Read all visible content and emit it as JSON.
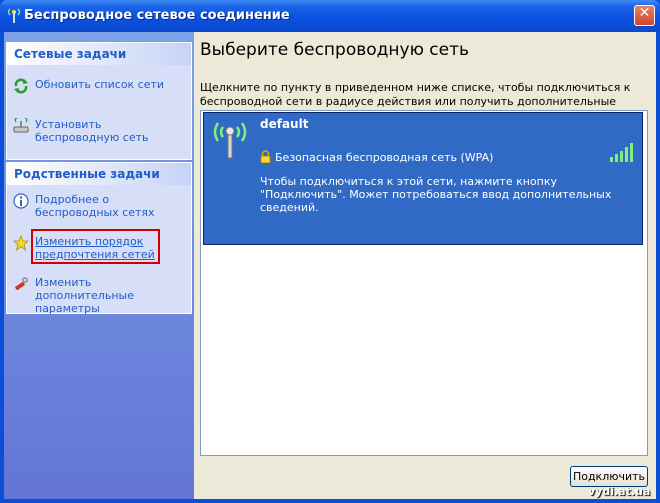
{
  "window": {
    "title": "Беспроводное сетевое соединение",
    "close_symbol": "✕"
  },
  "sidebar": {
    "network_tasks": {
      "title": "Сетевые задачи",
      "items": [
        {
          "label": "Обновить список сети",
          "icon": "refresh-arrows-icon"
        },
        {
          "label": "Установить беспроводную сеть",
          "icon": "setup-network-icon"
        }
      ]
    },
    "related_tasks": {
      "title": "Родственные задачи",
      "items": [
        {
          "label": "Подробнее о беспроводных сетях",
          "icon": "info-icon"
        },
        {
          "label": "Изменить порядок предпочтения сетей",
          "icon": "star-icon",
          "highlighted": true
        },
        {
          "label": "Изменить дополнительные параметры",
          "icon": "settings-wrench-icon"
        }
      ]
    }
  },
  "main": {
    "heading": "Выберите беспроводную сеть",
    "description": "Щелкните по пункту в приведенном ниже списке, чтобы подключиться к беспроводной сети в радиусе действия или получить дополнительные сведения.",
    "networks": [
      {
        "name": "default",
        "security": "Безопасная беспроводная сеть (WPA)",
        "help": "Чтобы подключиться к этой сети, нажмите кнопку \"Подключить\". Может потребоваться ввод дополнительных сведений.",
        "signal_bars": 5,
        "selected": true
      }
    ],
    "connect_label": "Подключить"
  },
  "watermark": "vydi.at.ua",
  "colors": {
    "highlight_border": "#d40000",
    "selection_bg": "#316ac5",
    "link": "#215dc6"
  }
}
